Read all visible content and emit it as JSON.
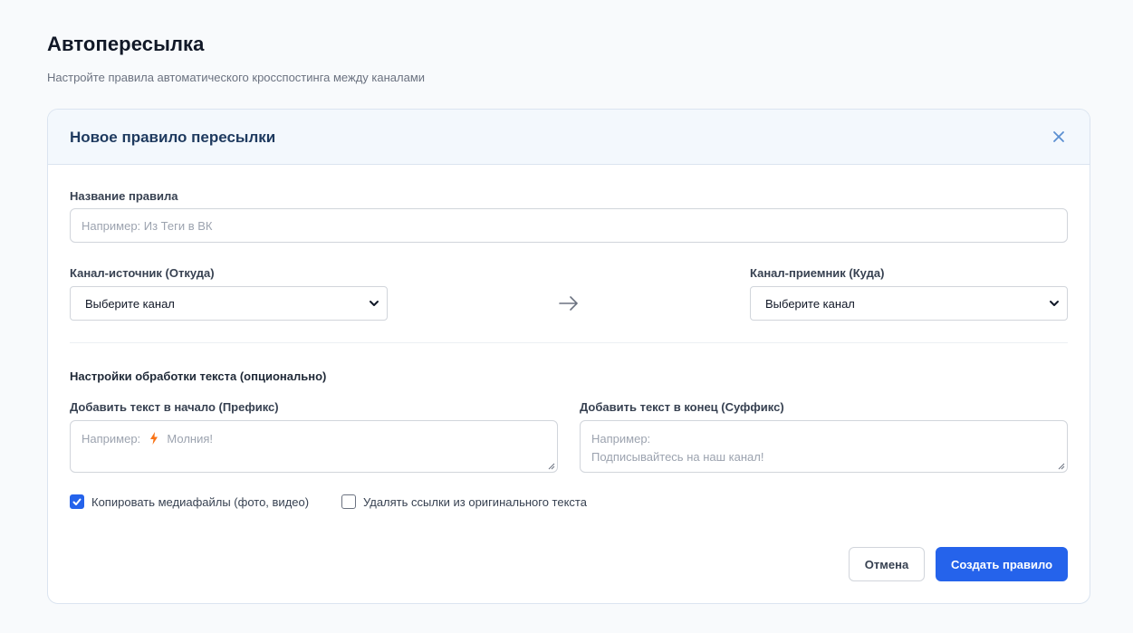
{
  "page": {
    "title": "Автопересылка",
    "subtitle": "Настройте правила автоматического кросспостинга между каналами"
  },
  "modal": {
    "title": "Новое правило пересылки",
    "close_icon": "close-icon"
  },
  "form": {
    "rule_name": {
      "label": "Название правила",
      "value": "",
      "placeholder": "Например: Из Теги в ВК"
    },
    "source_channel": {
      "label": "Канал-источник (Откуда)",
      "selected": "Выберите канал"
    },
    "target_channel": {
      "label": "Канал-приемник (Куда)",
      "selected": "Выберите канал"
    },
    "arrow_icon": "arrow-right-icon",
    "text_processing": {
      "section_title": "Настройки обработки текста (опционально)",
      "prefix": {
        "label": "Добавить текст в начало (Префикс)",
        "placeholder_before": "Например:",
        "placeholder_icon": "lightning-icon",
        "placeholder_after": "Молния!"
      },
      "suffix": {
        "label": "Добавить текст в конец (Суффикс)",
        "placeholder_line1": "Например:",
        "placeholder_line2": "Подписывайтесь на наш канал!"
      }
    },
    "options": {
      "copy_media": {
        "label": "Копировать медиафайлы (фото, видео)",
        "checked": true
      },
      "remove_links": {
        "label": "Удалять ссылки из оригинального текста",
        "checked": false
      }
    }
  },
  "actions": {
    "cancel_label": "Отмена",
    "create_label": "Создать правило"
  },
  "colors": {
    "accent": "#2563eb",
    "modal_header_bg": "#f3f8fd",
    "lightning": "#f97316"
  }
}
